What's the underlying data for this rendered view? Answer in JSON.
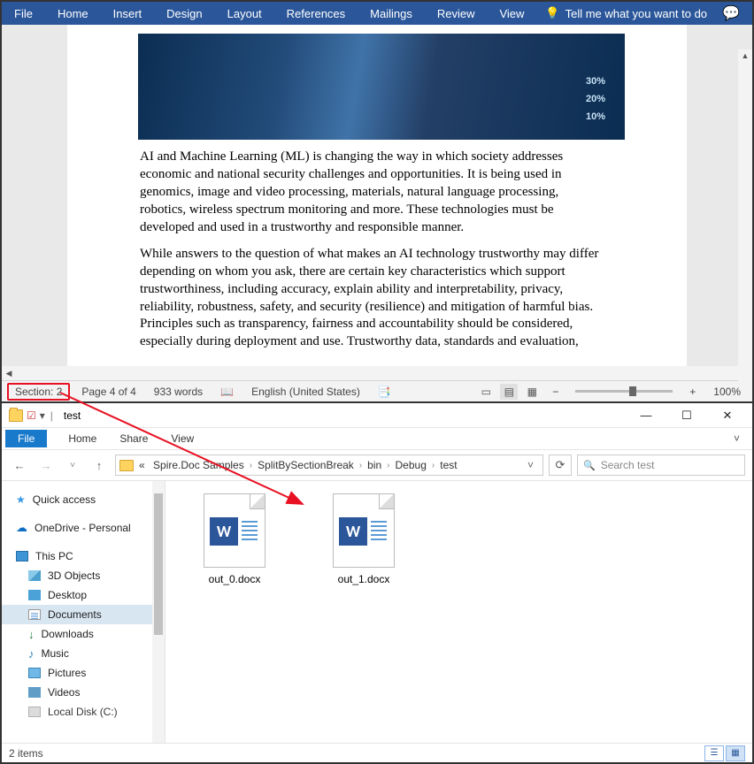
{
  "word": {
    "ribbon": [
      "File",
      "Home",
      "Insert",
      "Design",
      "Layout",
      "References",
      "Mailings",
      "Review",
      "View"
    ],
    "tell_me": "Tell me what you want to do",
    "hero_pcts": [
      "30%",
      "20%",
      "10%"
    ],
    "para1": "AI and Machine Learning (ML) is changing the way in which society addresses economic and national security challenges and opportunities. It is being used in genomics, image and video processing, materials, natural language processing, robotics, wireless spectrum monitoring and more. These technologies must be developed and used in a trustworthy and responsible manner.",
    "para2": "While answers to the question of what makes an AI technology trustworthy may differ depending on whom you ask, there are certain key characteristics which support trustworthiness, including accuracy, explain ability and interpretability, privacy, reliability, robustness, safety, and security (resilience) and mitigation of harmful bias. Principles such as transparency, fairness and accountability should be considered, especially during deployment and use. Trustworthy data, standards and evaluation,",
    "status": {
      "section": "Section: 2",
      "page": "Page 4 of 4",
      "words": "933 words",
      "lang": "English (United States)",
      "zoom": "100%"
    }
  },
  "explorer": {
    "title": "test",
    "ribbon": {
      "file": "File",
      "tabs": [
        "Home",
        "Share",
        "View"
      ]
    },
    "breadcrumbs": [
      "Spire.Doc Samples",
      "SplitBySectionBreak",
      "bin",
      "Debug",
      "test"
    ],
    "search_placeholder": "Search test",
    "nav": {
      "quick": "Quick access",
      "onedrive": "OneDrive - Personal",
      "thispc": "This PC",
      "items": [
        "3D Objects",
        "Desktop",
        "Documents",
        "Downloads",
        "Music",
        "Pictures",
        "Videos",
        "Local Disk (C:)"
      ]
    },
    "files": [
      "out_0.docx",
      "out_1.docx"
    ],
    "status": "2 items"
  }
}
